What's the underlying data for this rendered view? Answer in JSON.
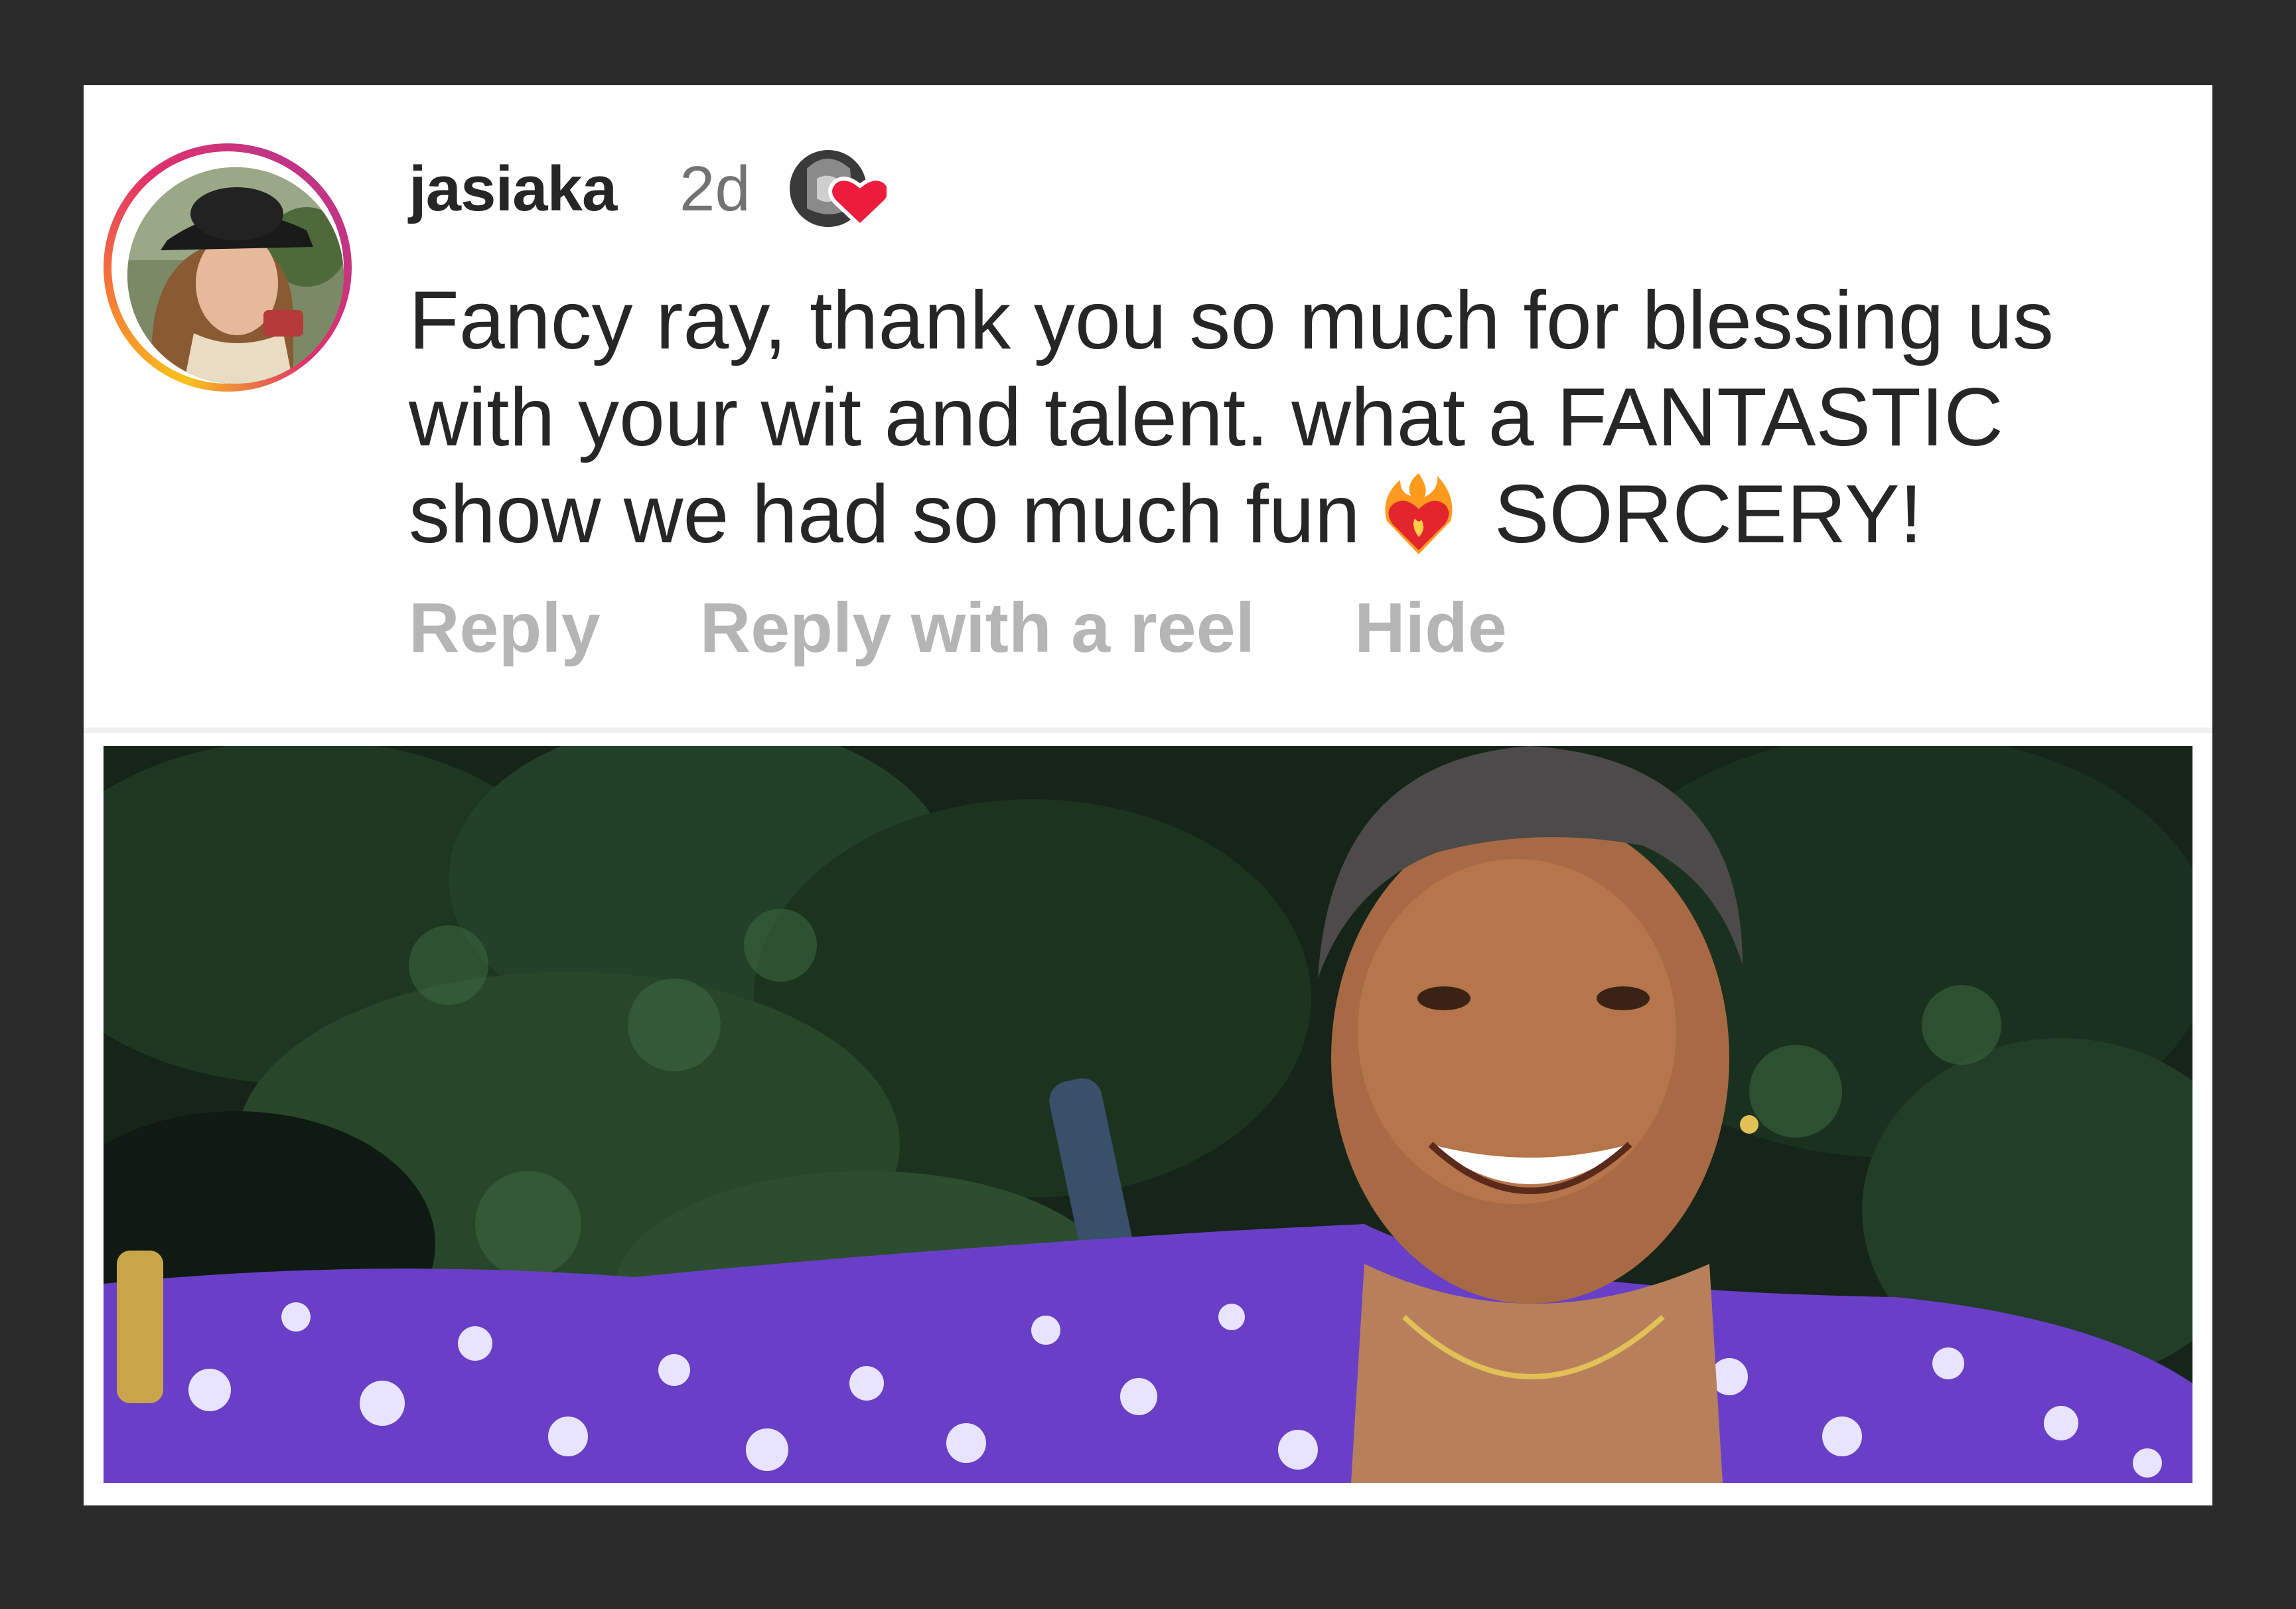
{
  "comment": {
    "username": "jasiaka",
    "timestamp": "2d",
    "text_lines": [
      "Fancy ray, thank you so much for blessing us",
      "with your wit and talent. what a FANTASTIC",
      "show we had so much fun"
    ],
    "text_tail": "SORCERY!",
    "emoji": "heart-on-fire",
    "actions": {
      "reply": "Reply",
      "reply_with_reel": "Reply with a reel",
      "hide": "Hide"
    }
  },
  "colors": {
    "background": "#2b2b2b",
    "card": "#ffffff",
    "text": "#262626",
    "muted": "#737373",
    "action": "#b5b5b5",
    "heart": "#ed1c3c",
    "shirt": "#6a3fc7"
  }
}
